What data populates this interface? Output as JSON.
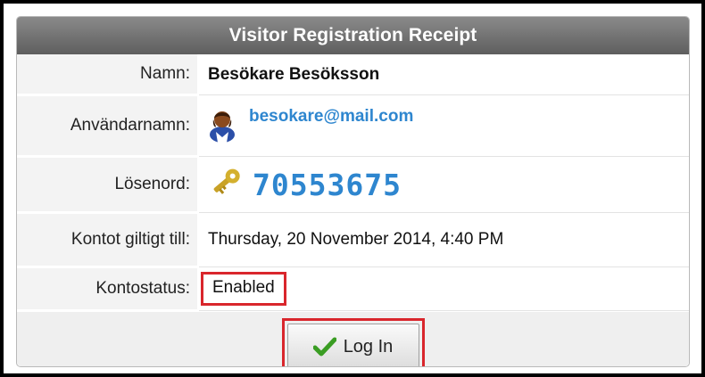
{
  "receipt": {
    "title": "Visitor Registration Receipt",
    "rows": {
      "name": {
        "label": "Namn:",
        "value": "Besökare Besöksson"
      },
      "username": {
        "label": "Användarnamn:",
        "value": "besokare@mail.com",
        "icon": "user-avatar-icon"
      },
      "password": {
        "label": "Lösenord:",
        "value": "70553675",
        "icon": "key-icon"
      },
      "valid_until": {
        "label": "Kontot giltigt till:",
        "value": "Thursday, 20 November 2014, 4:40 PM"
      },
      "status": {
        "label": "Kontostatus:",
        "value": "Enabled"
      }
    },
    "login_button": {
      "label": "Log In",
      "icon": "checkmark-icon"
    }
  },
  "colors": {
    "header_bg": "#6f6f6f",
    "accent_blue": "#2e86cf",
    "highlight_red": "#d9262c",
    "check_green": "#3a9d23"
  }
}
